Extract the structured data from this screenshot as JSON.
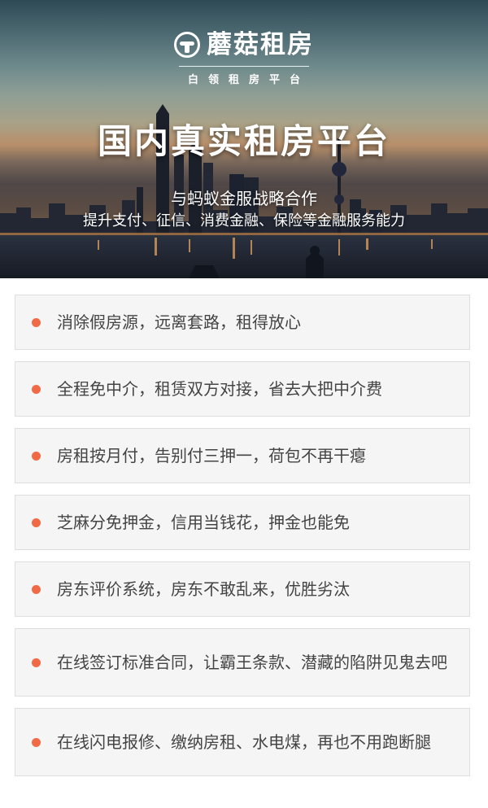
{
  "banner": {
    "logo_text": "蘑菇租房",
    "logo_subtitle": "白领租房平台",
    "headline": "国内真实租房平台",
    "partner_line": "与蚂蚁金服战略合作",
    "services_line": "提升支付、征信、消费金融、保险等金融服务能力",
    "icons": [
      "mushroom-logo-icon",
      "city-skyline-image"
    ]
  },
  "features": [
    {
      "text": "消除假房源，远离套路，租得放心"
    },
    {
      "text": "全程免中介，租赁双方对接，省去大把中介费"
    },
    {
      "text": "房租按月付，告别付三押一，荷包不再干瘪"
    },
    {
      "text": "芝麻分免押金，信用当钱花，押金也能免"
    },
    {
      "text": "房东评价系统，房东不敢乱来，优胜劣汰"
    },
    {
      "text": "在线签订标准合同，让霸王条款、潜藏的陷阱见鬼去吧"
    },
    {
      "text": "在线闪电报修、缴纳房租、水电煤，再也不用跑断腿"
    }
  ],
  "colors": {
    "bullet": "#f06a45",
    "card_background": "#f5f5f5",
    "card_border": "#dedede",
    "text": "#444444"
  }
}
